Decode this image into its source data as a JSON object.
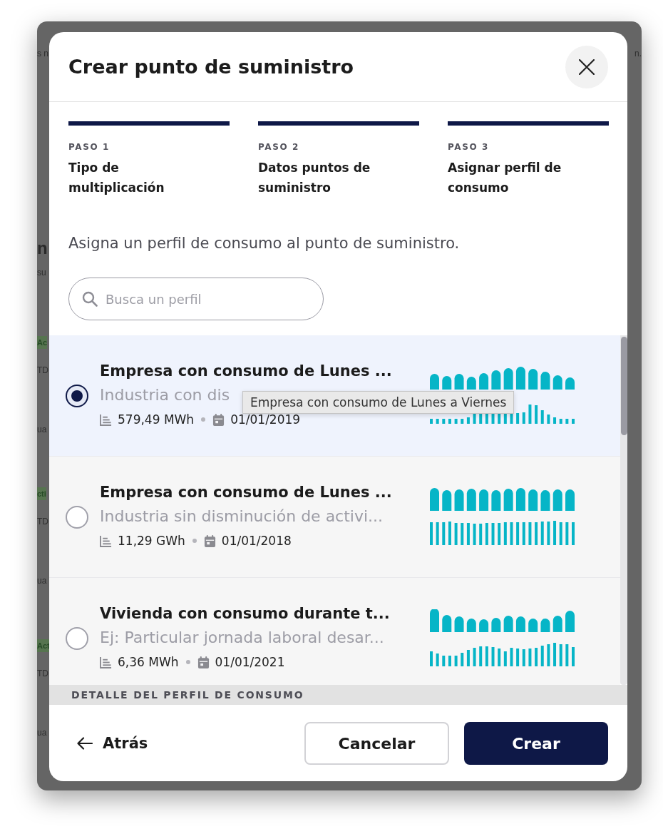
{
  "background_page": {
    "top_left": "s n",
    "top_right": "n.",
    "heading": "n",
    "subheading": "su",
    "rows": [
      {
        "badge": "Ac",
        "code": "TD",
        "name": "ua"
      },
      {
        "badge": "cti",
        "code": "TD",
        "name": "ua"
      },
      {
        "badge": "Act",
        "code": "TD",
        "name": "ua"
      }
    ]
  },
  "dialog": {
    "title": "Crear punto de suministro"
  },
  "steps": [
    {
      "label": "PASO 1",
      "title": "Tipo de multiplicación",
      "completed": true
    },
    {
      "label": "PASO 2",
      "title": "Datos puntos de suministro",
      "completed": true
    },
    {
      "label": "PASO 3",
      "title": "Asignar perfil de consumo",
      "completed": true
    }
  ],
  "description": "Asigna un perfil de consumo al punto de suministro.",
  "search": {
    "placeholder": "Busca un perfil"
  },
  "profiles": [
    {
      "title": "Empresa con consumo de Lunes ...",
      "description": "Industria con dis",
      "energy": "579,49 MWh",
      "date": "01/01/2019",
      "selected": true,
      "tooltip": "Empresa con consumo de Lunes a Viernes"
    },
    {
      "title": "Empresa con consumo de Lunes ...",
      "description": "Industria sin disminución de activi...",
      "energy": "11,29 GWh",
      "date": "01/01/2018",
      "selected": false
    },
    {
      "title": "Vivienda con consumo durante t...",
      "description": "Ej: Particular jornada laboral desar...",
      "energy": "6,36 MWh",
      "date": "01/01/2021",
      "selected": false
    }
  ],
  "section_header": "DETALLE DEL PERFIL DE CONSUMO",
  "footer": {
    "back": "Atrás",
    "cancel": "Cancelar",
    "create": "Crear"
  }
}
